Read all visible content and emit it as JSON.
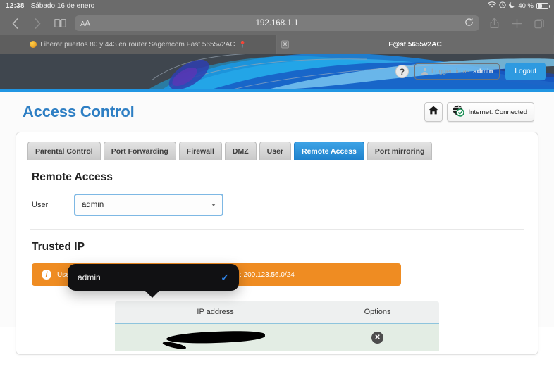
{
  "status_bar": {
    "time": "12:38",
    "date": "Sábado 16 de enero",
    "wifi_icon": "wifi-icon",
    "alarm_icon": "alarm-clock-icon",
    "moon_icon": "moon-icon",
    "battery_percent": "40 %"
  },
  "browser": {
    "back_icon": "back-chevron-icon",
    "forward_icon": "forward-chevron-icon",
    "bookmarks_icon": "book-icon",
    "text_size_label": "AA",
    "url": "192.168.1.1",
    "reload_icon": "reload-icon",
    "share_icon": "share-icon",
    "new_tab_icon": "plus-icon",
    "tabs_overview_icon": "tabs-icon",
    "tabs": [
      {
        "title": "Liberar puertos 80 y 443 en router Sagemcom Fast 5655v2AC",
        "pin_icon": "pin-icon",
        "close_icon": "close-icon",
        "active": false
      },
      {
        "title": "F@st 5655v2AC",
        "close_icon": "close-icon",
        "active": true
      }
    ]
  },
  "router_header": {
    "help_label": "?",
    "logged_in_prefix": "Logged in as",
    "logged_in_user": "admin",
    "user_icon": "person-icon",
    "logout_label": "Logout",
    "accent_color": "#2196e3",
    "background_color": "#3f464e"
  },
  "page": {
    "title": "Access Control",
    "home_icon": "home-icon",
    "internet_icon": "globe-connected-icon",
    "internet_status": "Internet:  Connected"
  },
  "nav_tabs": [
    {
      "label": "Parental Control",
      "active": false
    },
    {
      "label": "Port Forwarding",
      "active": false
    },
    {
      "label": "Firewall",
      "active": false
    },
    {
      "label": "DMZ",
      "active": false
    },
    {
      "label": "User",
      "active": false
    },
    {
      "label": "Remote Access",
      "active": true
    },
    {
      "label": "Port mirroring",
      "active": false
    }
  ],
  "remote_access": {
    "section_title": "Remote Access",
    "user_label": "User",
    "user_value": "admin",
    "caret_icon": "chevron-down-icon"
  },
  "trusted_ip": {
    "section_title": "Trusted IP",
    "alert_icon": "info-icon",
    "alert_text": "Use format as in following example for network addresses : 200.123.56.0/24",
    "alert_color": "#ef8c22",
    "table": {
      "columns": [
        "IP address",
        "Options"
      ],
      "rows": [
        {
          "ip_address": "",
          "redacted": true,
          "delete_icon": "delete-circle-icon"
        }
      ]
    }
  },
  "select_popup": {
    "option_label": "admin",
    "check_icon": "checkmark-icon",
    "check_color": "#2f84e8",
    "background_color": "#111113"
  }
}
